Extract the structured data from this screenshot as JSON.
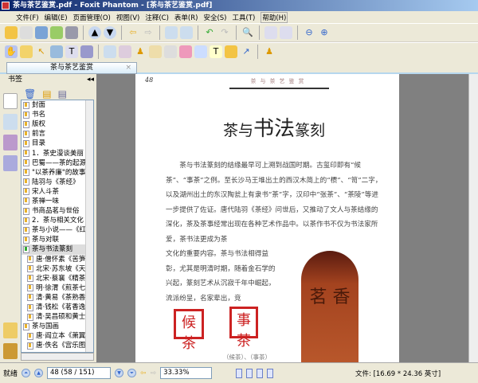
{
  "window": {
    "title": "茶与茶艺鉴赏.pdf - Foxit Phantom - [茶与茶艺鉴赏.pdf]"
  },
  "menu": [
    "文件(F)",
    "编辑(E)",
    "页面管理(O)",
    "视图(V)",
    "注释(C)",
    "表单(R)",
    "安全(S)",
    "工具(T)",
    "帮助(H)"
  ],
  "tab": {
    "label": "茶与茶艺鉴赏",
    "close": "×"
  },
  "sidebar": {
    "title": "书签",
    "collapse": "◂◂",
    "items": [
      {
        "label": "封面"
      },
      {
        "label": "书名"
      },
      {
        "label": "版权"
      },
      {
        "label": "前言"
      },
      {
        "label": "目录"
      },
      {
        "label": "1．茶史漫谈美丽"
      },
      {
        "label": "巴蜀——茶的起源"
      },
      {
        "label": "\"以茶养廉\"的故事"
      },
      {
        "label": "陆羽与《茶经》"
      },
      {
        "label": "宋人斗茶"
      },
      {
        "label": "茶禅一味"
      },
      {
        "label": "书商品茗与世俗"
      },
      {
        "label": "2．茶与相关文化"
      },
      {
        "label": "茶与小说——《红"
      },
      {
        "label": "茶与对联"
      },
      {
        "label": "茶与书法篆刻",
        "selected": true
      },
      {
        "label": "唐·僧怀素《苦笋",
        "sub": true
      },
      {
        "label": "北宋·苏东坡《天",
        "sub": true
      },
      {
        "label": "北宋·蔡襄《精茶",
        "sub": true
      },
      {
        "label": "明·徐渭《煎茶七",
        "sub": true
      },
      {
        "label": "清·黄易《茶熟香",
        "sub": true
      },
      {
        "label": "清·钱松《茗香逸",
        "sub": true
      },
      {
        "label": "清·吴昌硕和黄士",
        "sub": true
      },
      {
        "label": "茶与国画"
      },
      {
        "label": "唐·阎立本《萧翼",
        "sub": true
      },
      {
        "label": "唐·佚名《宫乐图》",
        "sub": true
      }
    ]
  },
  "page": {
    "number": "48",
    "running_head": "茶与茶艺鉴赏",
    "title_pre": "茶与",
    "title_big": "书法",
    "title_post": "篆刻",
    "para": "茶与书法篆刻的结缘最早可上溯到战国时期。古玺印即有“候茶”、“事茶”之例。至长沙马王堆出土的西汉木简上的“槚”、“笥”二字，以及湖州出土的东汉陶瓮上有隶书“茶”字，汉印中“张茶”、“茶陵”等进一步提供了佐证。唐代陆羽《茶经》问世后，又推动了文人与茶结缘的深化，茶及茶事经常出现在各种艺术作品中。以茶作书不仅为书法家所爱，茶书法更成为茶",
    "para2": "文化的重要内容。茶与书法相得益彰，尤其是明清时期，随着金石学的兴起，篆刻艺术从沉寂千年中崛起，流派纷呈，名家辈出，竞",
    "seal1": "候茶",
    "seal2": "事茶",
    "stamp": "茗 香",
    "caption": "（候茶）、（事茶）"
  },
  "status": {
    "ready": "就绪",
    "page_field": "48 (58 / 151)",
    "zoom": "33.33%",
    "doc_size": "文件: [16.69 * 24.36 英寸]"
  }
}
